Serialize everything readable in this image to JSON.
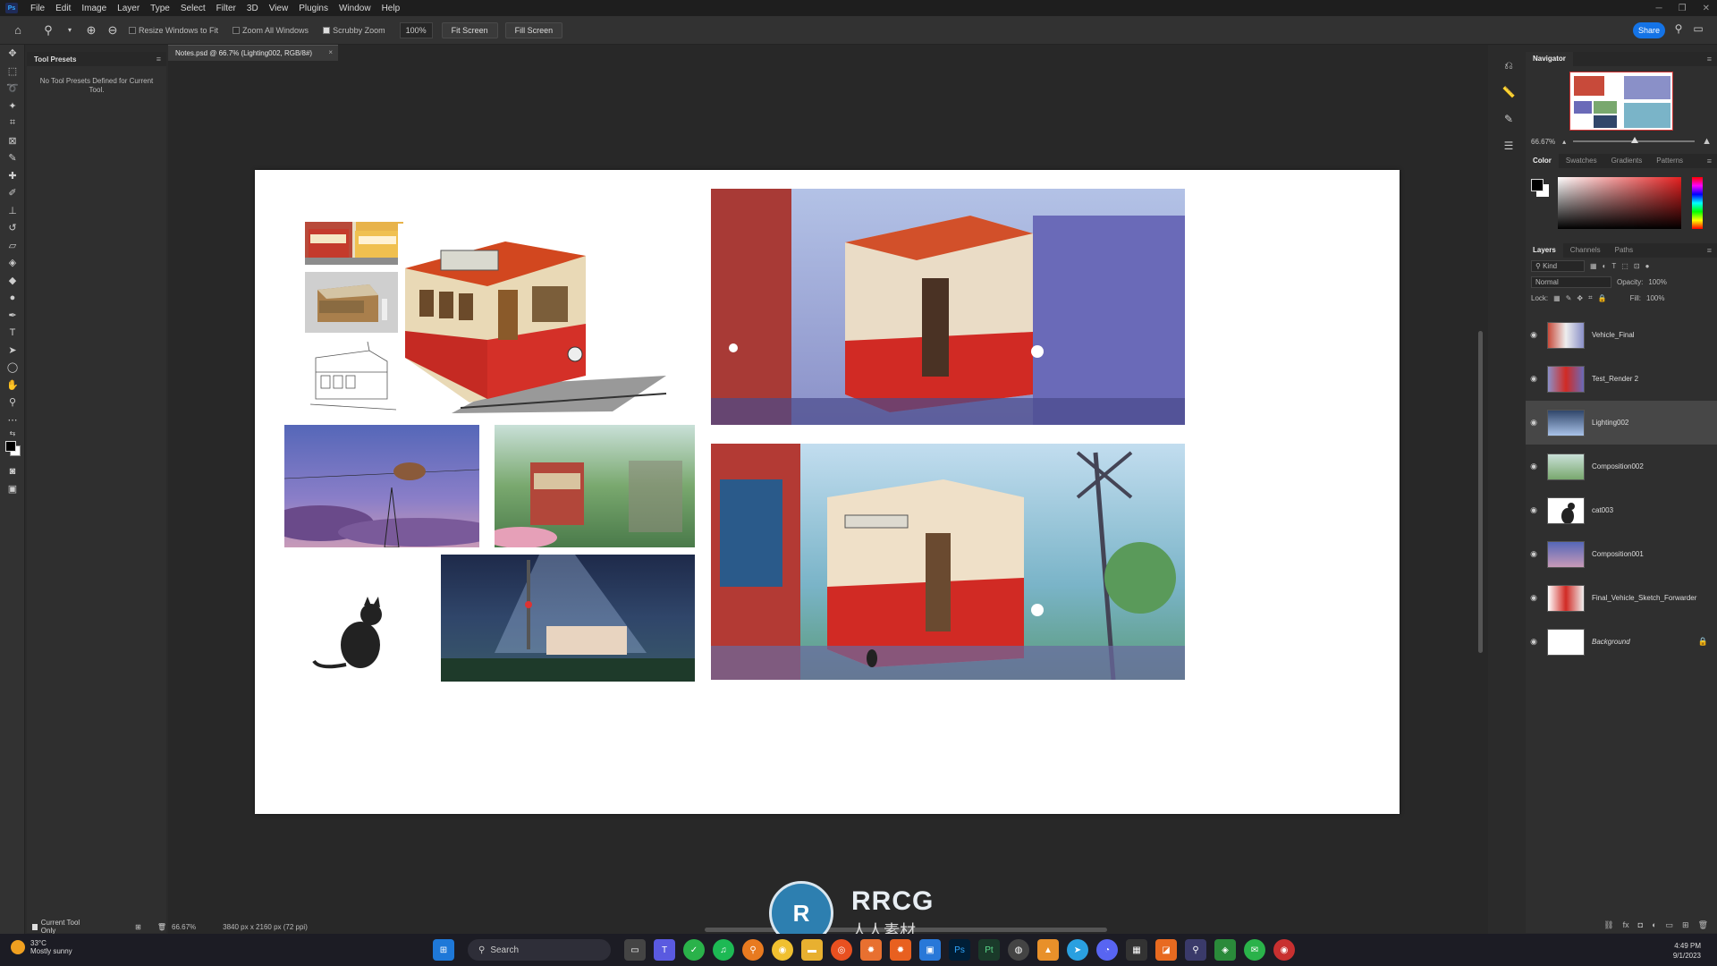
{
  "menu": {
    "items": [
      "File",
      "Edit",
      "Image",
      "Layer",
      "Type",
      "Select",
      "Filter",
      "3D",
      "View",
      "Plugins",
      "Window",
      "Help"
    ]
  },
  "options": {
    "resize_windows": "Resize Windows to Fit",
    "zoom_all": "Zoom All Windows",
    "scrubby_zoom": "Scrubby Zoom",
    "zoom_value": "100%",
    "fit_screen": "Fit Screen",
    "fill_screen": "Fill Screen",
    "share": "Share"
  },
  "presets": {
    "title": "Tool Presets",
    "message": "No Tool Presets Defined for Current Tool.",
    "current_tool_only": "Current Tool Only"
  },
  "document": {
    "tab_title": "Notes.psd @ 66.7% (Lighting002, RGB/8#)",
    "zoom": "66.67%",
    "dimensions": "3840 px x 2160 px (72 ppi)"
  },
  "navigator": {
    "title": "Navigator",
    "zoom": "66.67%"
  },
  "color_panel": {
    "tabs": [
      "Color",
      "Swatches",
      "Gradients",
      "Patterns"
    ]
  },
  "layers_panel": {
    "tabs": [
      "Layers",
      "Channels",
      "Paths"
    ],
    "kind": "Kind",
    "blend_mode": "Normal",
    "opacity_label": "Opacity:",
    "opacity_value": "100%",
    "lock_label": "Lock:",
    "fill_label": "Fill:",
    "fill_value": "100%",
    "layers": [
      {
        "name": "Vehicle_Final"
      },
      {
        "name": "Test_Render 2"
      },
      {
        "name": "Lighting002"
      },
      {
        "name": "Composition002"
      },
      {
        "name": "cat003"
      },
      {
        "name": "Composition001"
      },
      {
        "name": "Final_Vehicle_Sketch_Forwarder"
      },
      {
        "name": "Background"
      }
    ]
  },
  "watermark": {
    "brand": "RRCG",
    "sub": "人人素材"
  },
  "taskbar": {
    "weather_temp": "33°C",
    "weather_desc": "Mostly sunny",
    "search": "Search",
    "time": "4:49 PM",
    "date": "9/1/2023"
  }
}
